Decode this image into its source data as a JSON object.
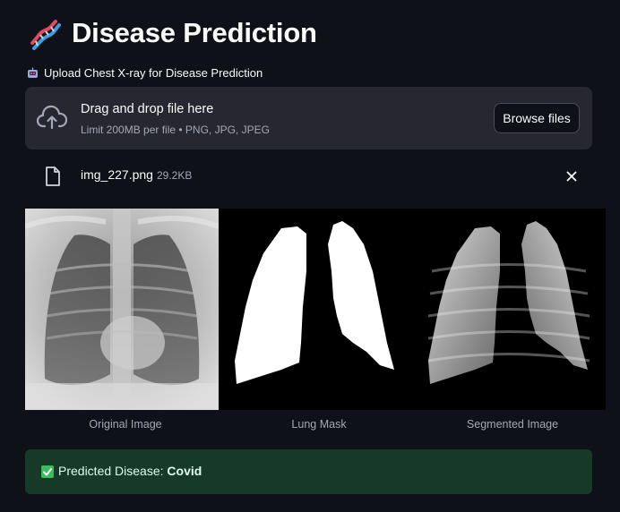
{
  "header": {
    "title": "Disease Prediction",
    "title_icon": "dna-icon"
  },
  "uploader": {
    "label": "Upload Chest X-ray for Disease Prediction",
    "label_icon": "robot-icon",
    "drop_text": "Drag and drop file here",
    "limit_text": "Limit 200MB per file • PNG, JPG, JPEG",
    "browse_label": "Browse files",
    "cloud_icon": "cloud-upload-icon"
  },
  "file": {
    "name": "img_227.png",
    "size": "29.2KB",
    "file_icon": "file-icon",
    "remove_icon": "close-icon"
  },
  "images": [
    {
      "caption": "Original Image"
    },
    {
      "caption": "Lung Mask"
    },
    {
      "caption": "Segmented Image"
    }
  ],
  "result": {
    "prefix": "Predicted Disease:",
    "value": "Covid",
    "icon": "check-icon"
  },
  "colors": {
    "background": "#0e1117",
    "dropzone": "#262730",
    "success_bg": "#173928",
    "success_text": "#dffde9",
    "muted_text": "#a3a8b8"
  }
}
